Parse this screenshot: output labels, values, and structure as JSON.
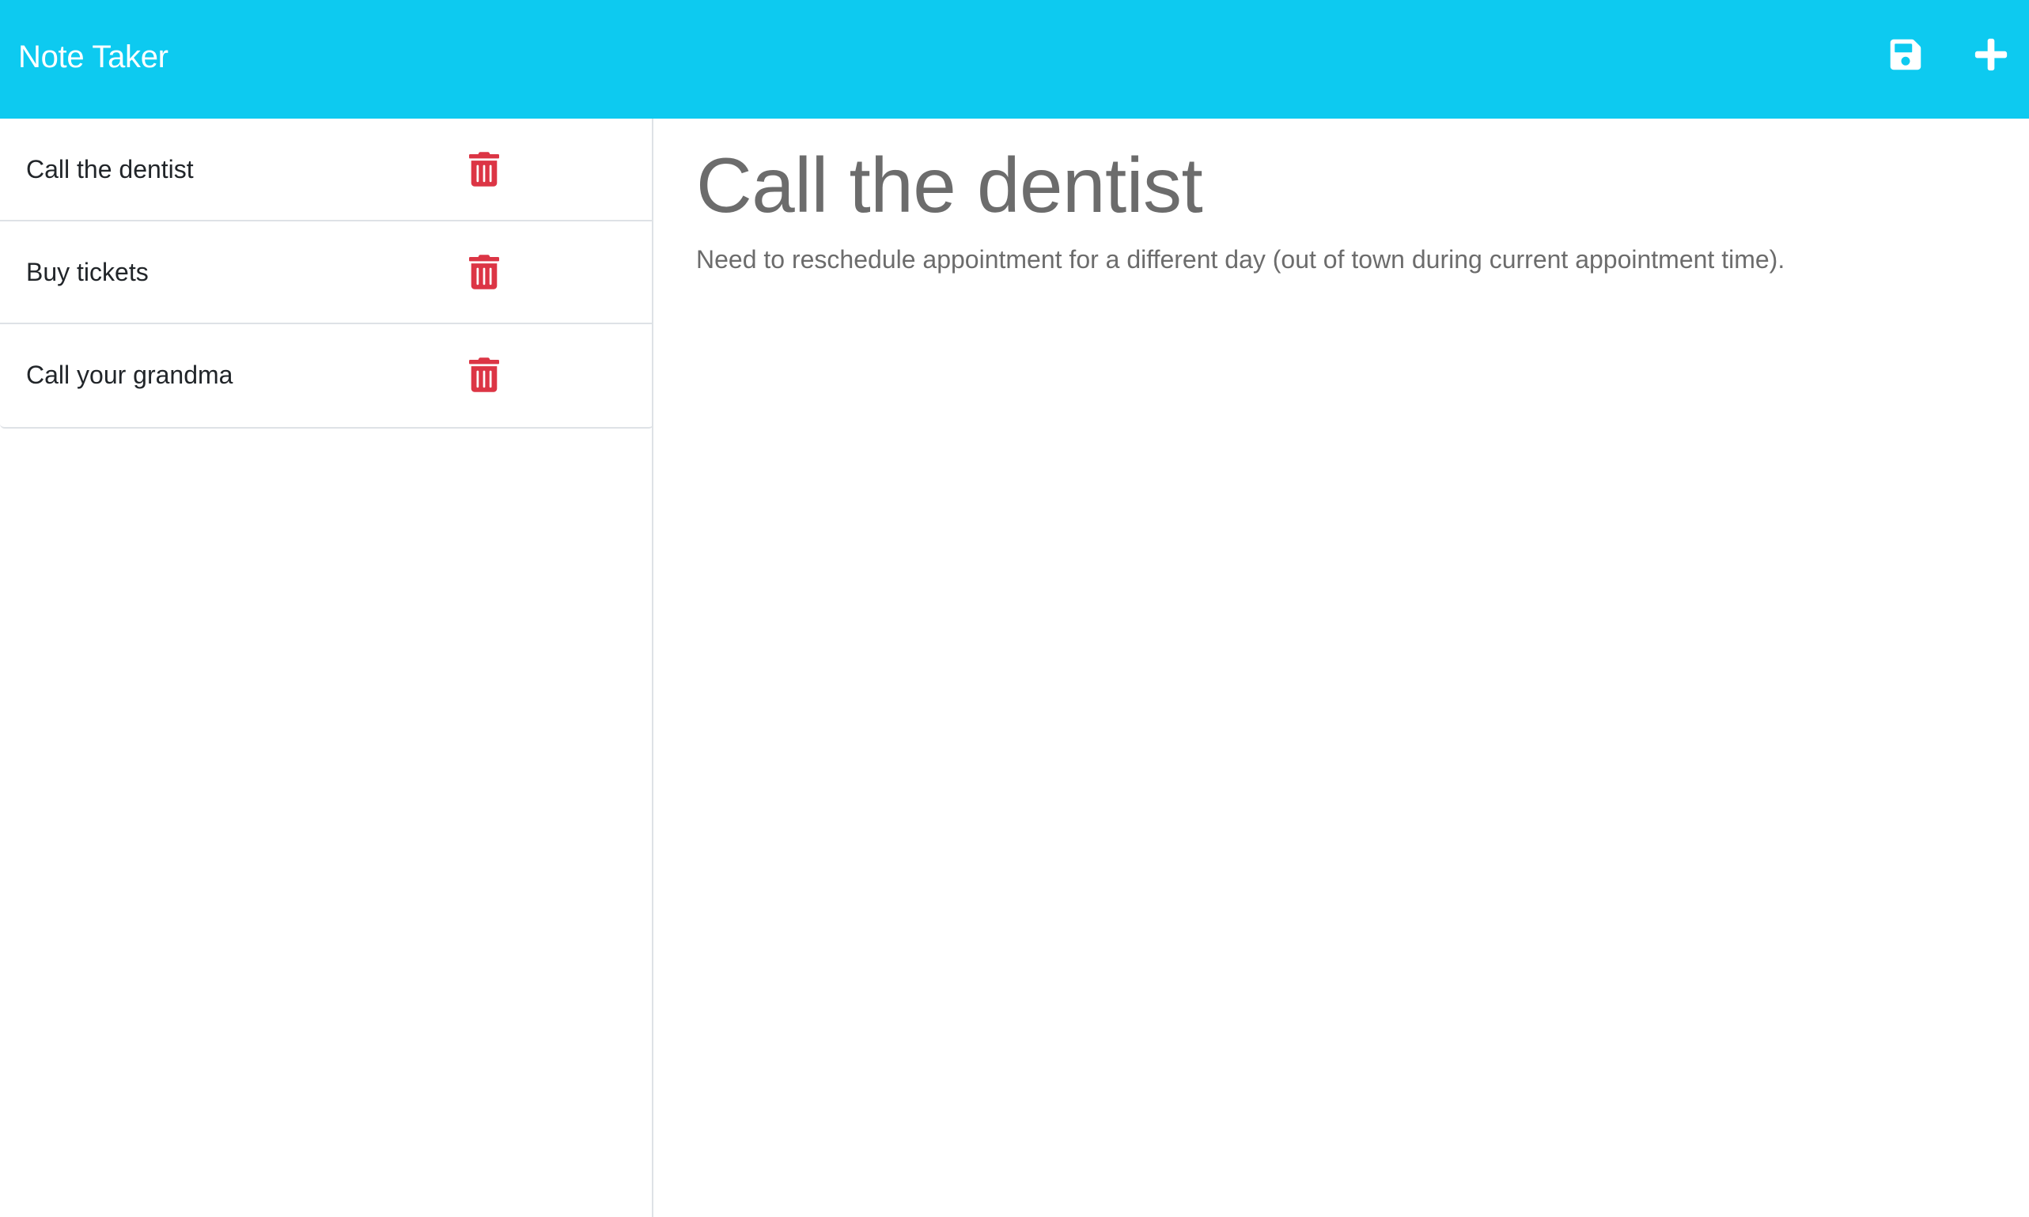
{
  "app": {
    "brand": "Note Taker",
    "accent_color": "#0dcaf0"
  },
  "toolbar": {
    "save_icon": "save-icon",
    "new_icon": "plus-icon"
  },
  "notes": [
    {
      "title": "Call the dentist",
      "delete_icon": "trash-icon"
    },
    {
      "title": "Buy tickets",
      "delete_icon": "trash-icon"
    },
    {
      "title": "Call your grandma",
      "delete_icon": "trash-icon"
    }
  ],
  "active_note": {
    "title": "Call the dentist",
    "text": "Need to reschedule appointment for a different day (out of town during current appointment time)."
  },
  "colors": {
    "delete": "#dc3545",
    "text_muted": "#6c6c6c",
    "border": "#dee2e6"
  }
}
